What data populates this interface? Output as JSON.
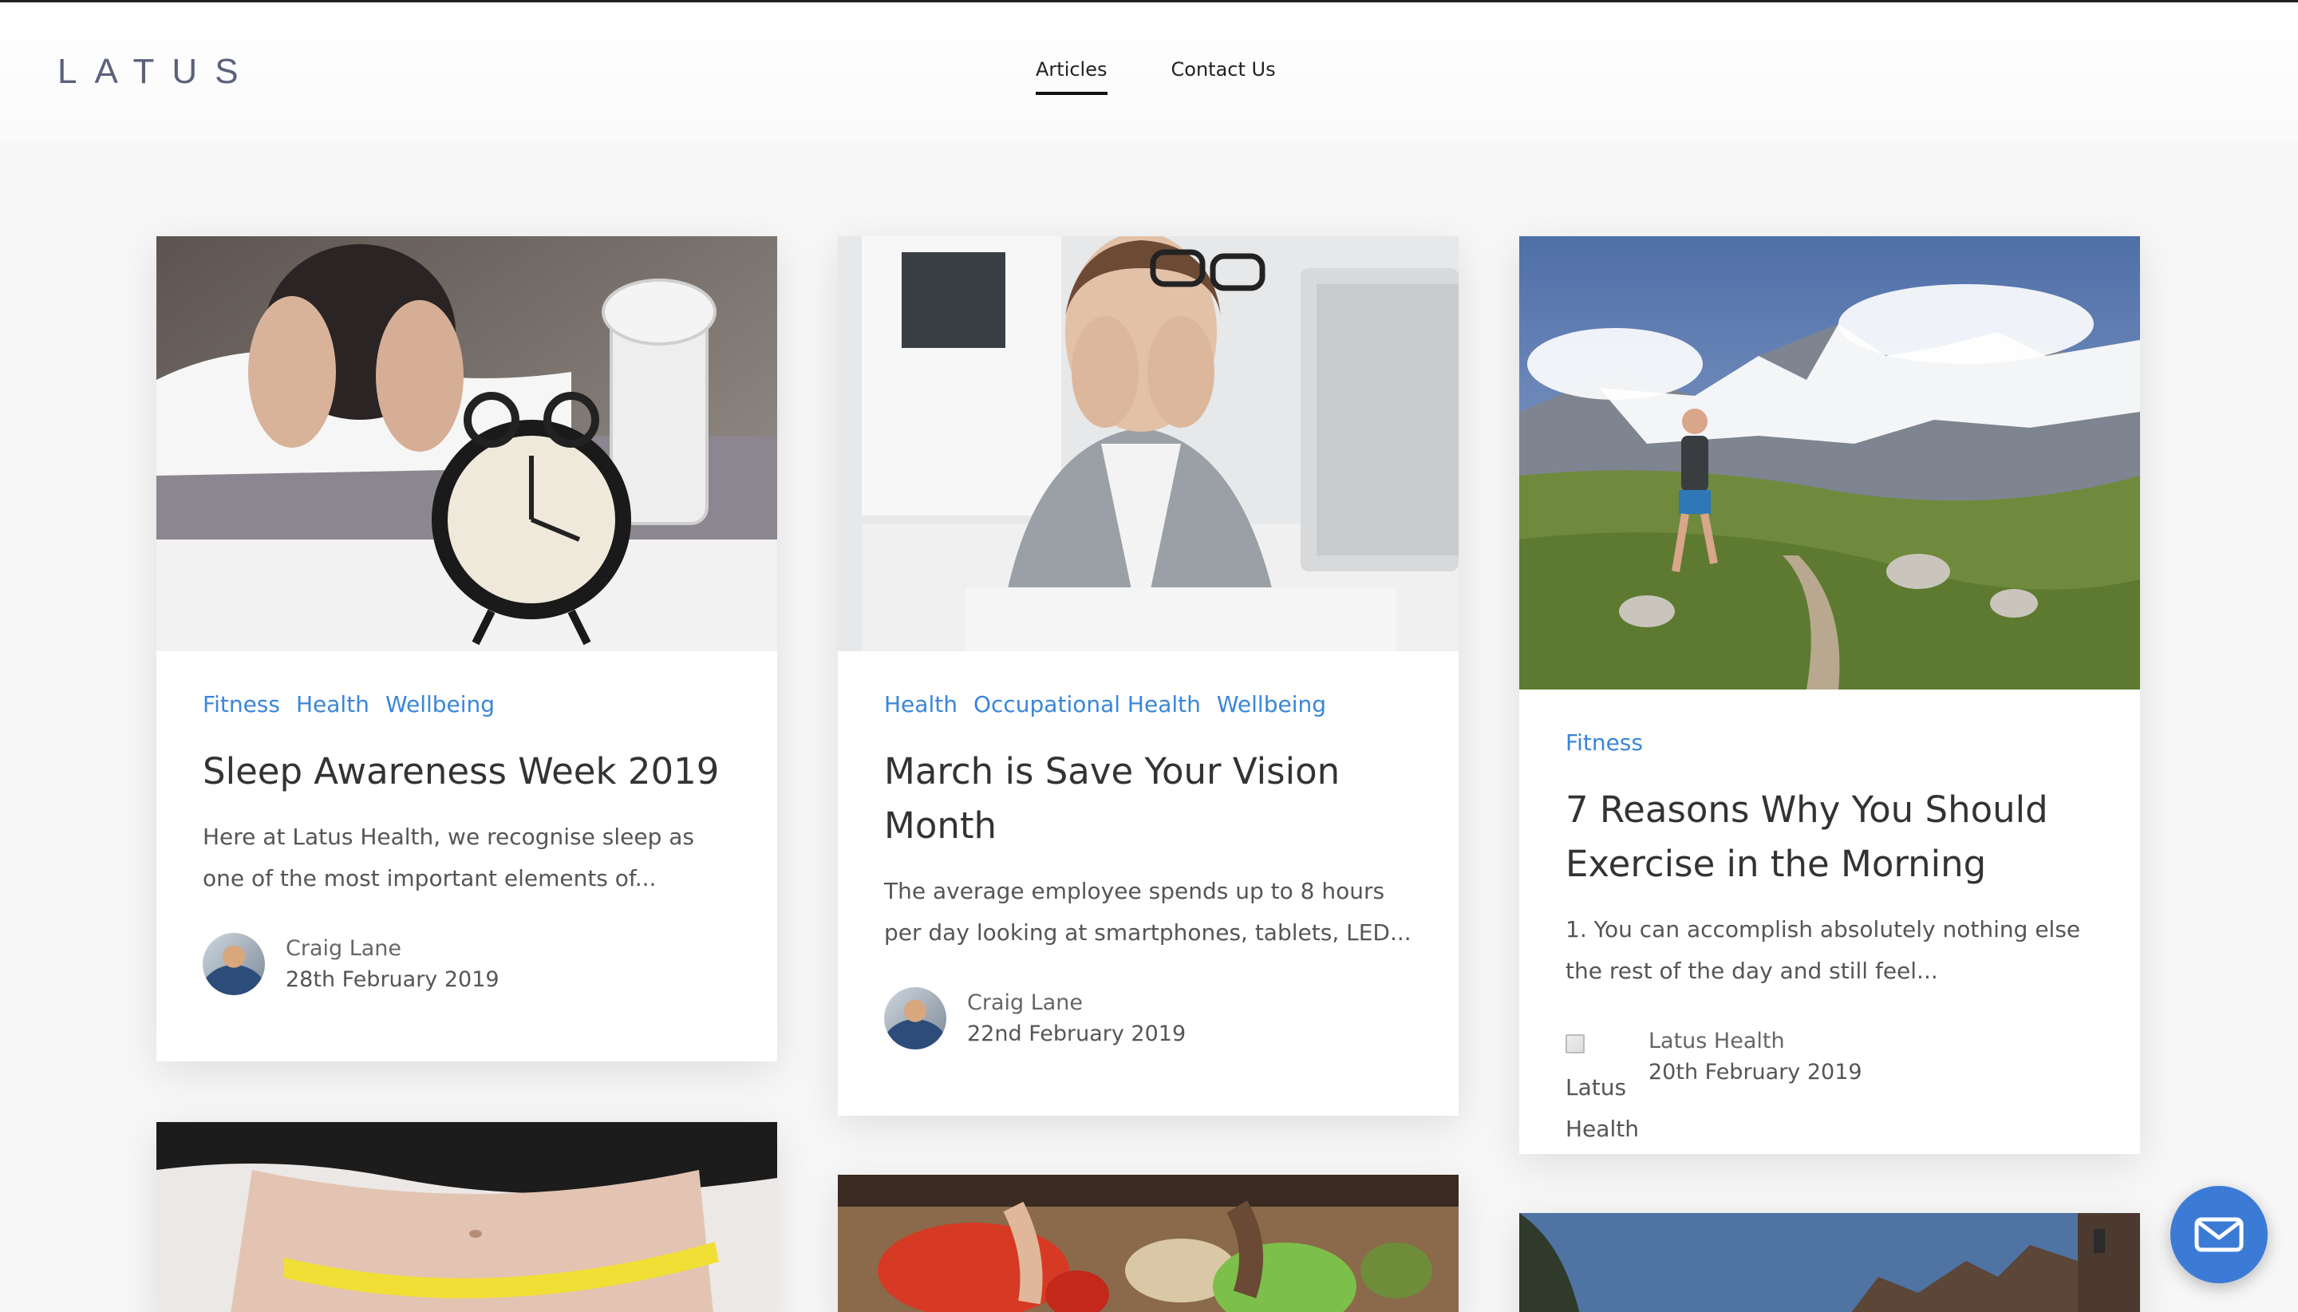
{
  "brand": {
    "logo_text": "LATUS"
  },
  "nav": [
    {
      "label": "Articles",
      "active": true
    },
    {
      "label": "Contact Us",
      "active": false
    }
  ],
  "articles": [
    {
      "tags": [
        "Fitness",
        "Health",
        "Wellbeing"
      ],
      "title": "Sleep Awareness Week 2019",
      "excerpt": "Here at Latus Health, we recognise sleep as one of the most important elements of...",
      "author": "Craig Lane",
      "date": "28th February 2019"
    },
    {
      "tags": [
        "Health",
        "Occupational Health",
        "Wellbeing"
      ],
      "title": "March is Save Your Vision Month",
      "excerpt": "The average employee spends up to 8 hours per day looking at smartphones, tablets, LED...",
      "author": "Craig Lane",
      "date": "22nd February 2019"
    },
    {
      "tags": [
        "Fitness"
      ],
      "title": "7 Reasons Why You Should Exercise in the Morning",
      "excerpt": "1. You can accomplish absolutely nothing else the rest of the day and still feel...",
      "author": "Latus Health",
      "author_image_alt": "Latus Health",
      "date": "20th February 2019"
    }
  ],
  "fab": {
    "icon": "envelope-icon"
  },
  "colors": {
    "accent": "#3a86d9",
    "fab": "#3b7bd6"
  }
}
